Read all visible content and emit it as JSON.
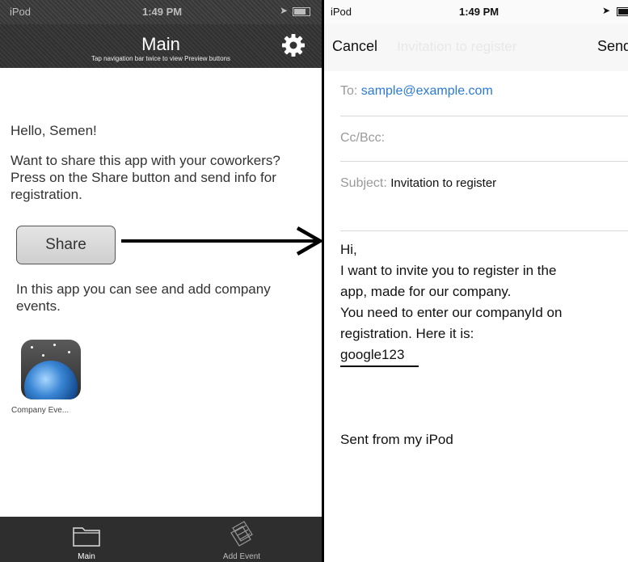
{
  "left_screen": {
    "status_bar": {
      "carrier": "iPod",
      "time": "1:49 PM"
    },
    "nav": {
      "title": "Main",
      "hint": "Tap navigation bar twice to view Preview buttons"
    },
    "greeting": "Hello, Semen!",
    "share_text": "Want to share this app with your coworkers? Press on the Share button and send info for registration.",
    "share_button": "Share",
    "events_text": "In this app you can see and add company events.",
    "app_label": "Company Eve...",
    "tabs": [
      {
        "label": "Main",
        "icon": "folder-icon"
      },
      {
        "label": "Add Event",
        "icon": "add-event-icon"
      }
    ]
  },
  "right_screen": {
    "status_bar": {
      "carrier": "iPod",
      "time": "1:49 PM"
    },
    "nav": {
      "cancel": "Cancel",
      "title": "Invitation to register",
      "send": "Send"
    },
    "to": {
      "label": "To:",
      "value": "sample@example.com"
    },
    "cc": {
      "label": "Cc/Bcc:"
    },
    "subject": {
      "label": "Subject:",
      "value": "Invitation to register"
    },
    "body": {
      "line1": "Hi,",
      "line2": "I want to invite you to register in the",
      "line3": "app, made for our company.",
      "line4": "You need to enter our companyId on",
      "line5": "registration. Here it is:",
      "code": "google123"
    },
    "signature": "Sent from my iPod"
  },
  "colors": {
    "link": "#2a7ad6",
    "bar_dark": "#333333",
    "arrow": "#000000"
  }
}
